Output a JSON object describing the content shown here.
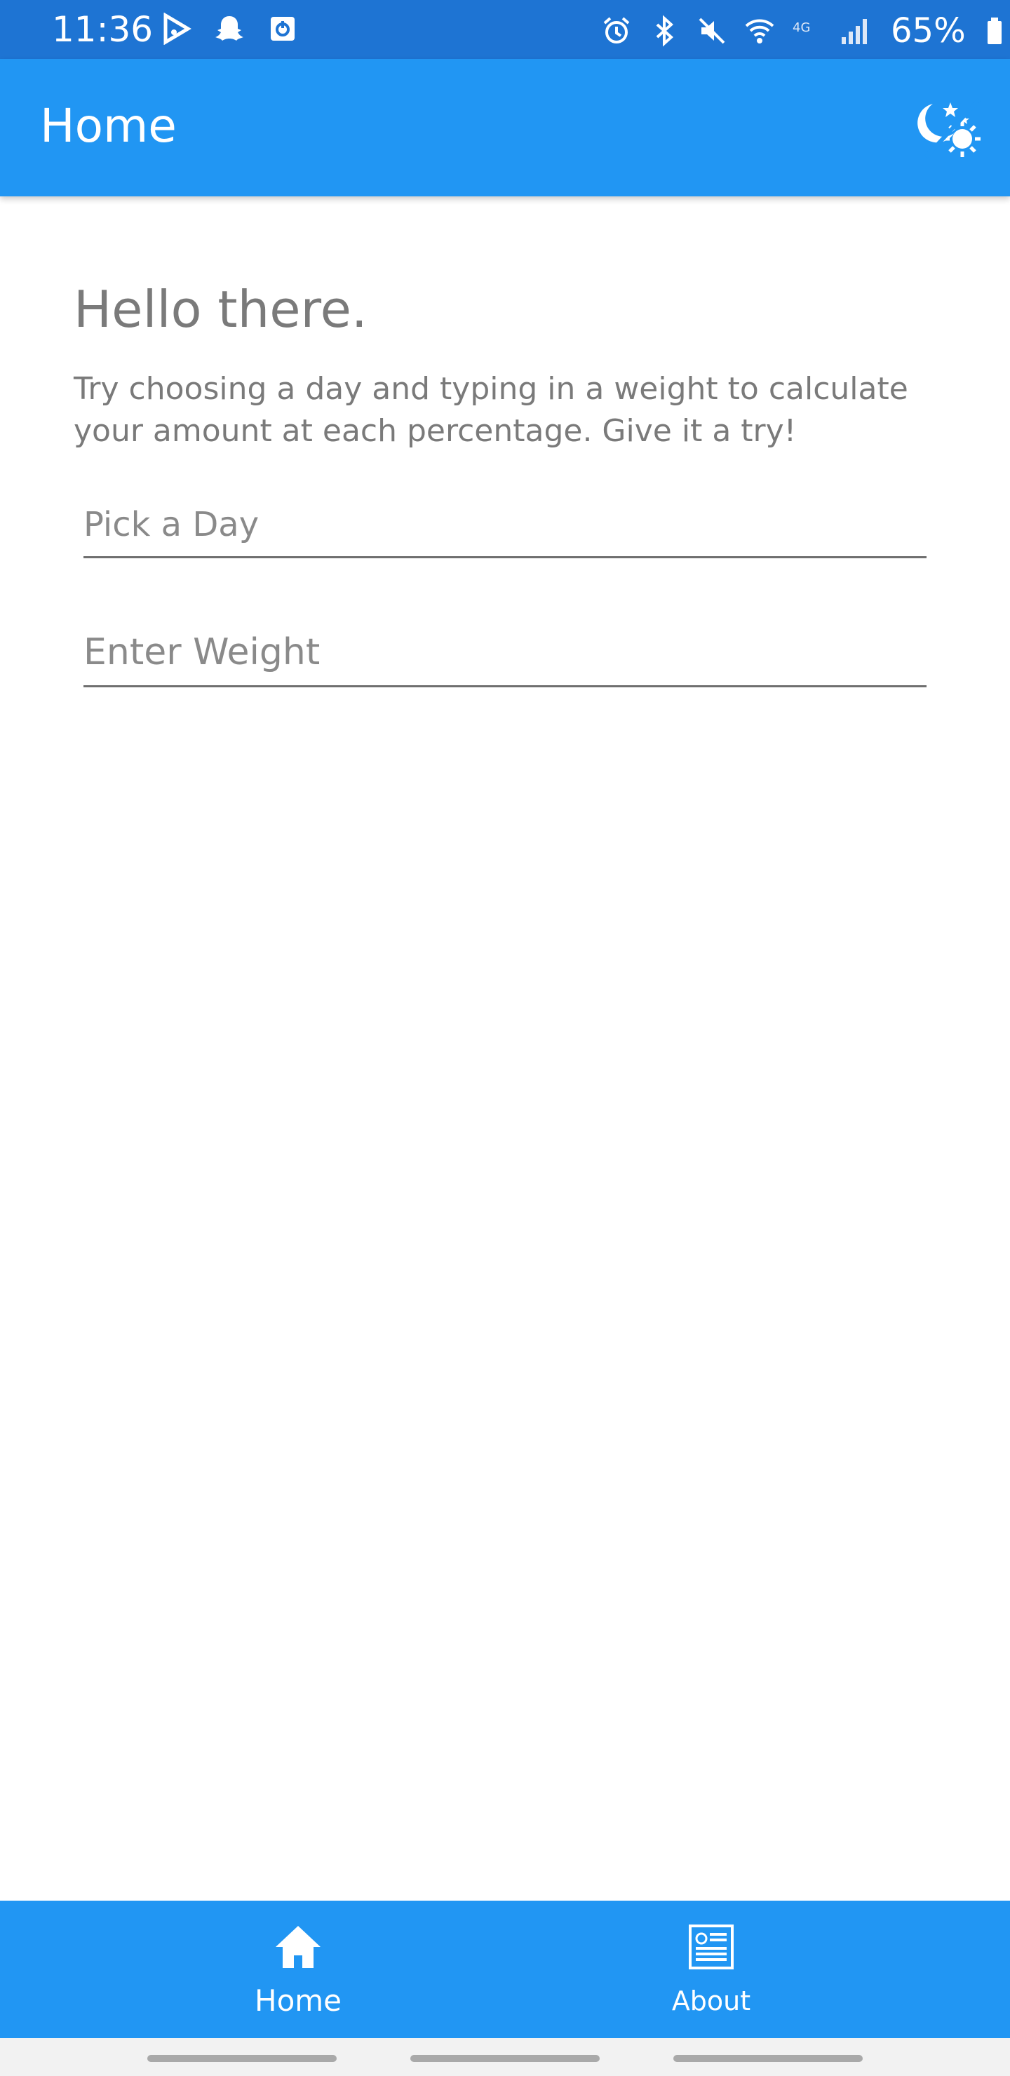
{
  "status_bar": {
    "time": "11:36",
    "battery_percent": "65%",
    "left_icons": [
      "music-play-icon",
      "snapchat-ghost-icon",
      "app-notification-icon"
    ],
    "right_icons": [
      "alarm-icon",
      "bluetooth-icon",
      "mute-icon",
      "wifi-icon",
      "lte-icon",
      "signal-icon",
      "battery-icon"
    ],
    "network_type": "4G"
  },
  "app_bar": {
    "title": "Home",
    "theme_toggle_icon": "day-night-toggle-icon"
  },
  "main": {
    "greeting": "Hello there.",
    "intro": "Try choosing a day and typing in a weight to calculate your amount at each percentage. Give it a try!",
    "day_field": {
      "placeholder": "Pick a Day",
      "value": ""
    },
    "weight_field": {
      "placeholder": "Enter Weight",
      "value": ""
    }
  },
  "tab_bar": {
    "tabs": [
      {
        "label": "Home",
        "icon": "home-icon",
        "selected": true
      },
      {
        "label": "About",
        "icon": "about-icon",
        "selected": false
      }
    ]
  },
  "colors": {
    "status_bar": "#1e74d3",
    "primary": "#2196f3",
    "text_gray": "#7a7a7a",
    "nav_bar": "#f2f2f2"
  }
}
